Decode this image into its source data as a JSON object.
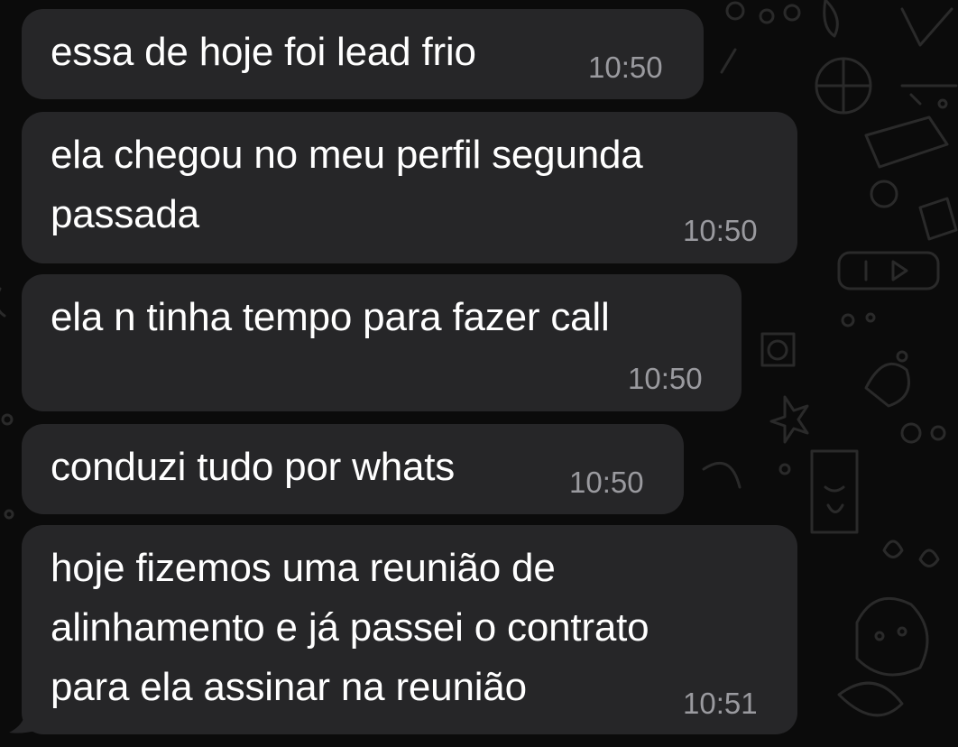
{
  "messages": [
    {
      "text": [
        "essa de hoje foi lead frio"
      ],
      "time": "10:50"
    },
    {
      "text": [
        "ela chegou no meu perfil segunda",
        "passada"
      ],
      "time": "10:50"
    },
    {
      "text": [
        "ela n tinha tempo para fazer call"
      ],
      "time": "10:50"
    },
    {
      "text": [
        "conduzi tudo por whats"
      ],
      "time": "10:50"
    },
    {
      "text": [
        "hoje fizemos uma reunião de",
        "alinhamento e já passei o contrato",
        "para ela assinar na reunião"
      ],
      "time": "10:51"
    }
  ],
  "theme": {
    "background": "#0b0b0b",
    "bubble": "#262628",
    "text": "#ffffff",
    "timestamp": "#9a9a9f",
    "doodle": "#2a2a2a"
  }
}
